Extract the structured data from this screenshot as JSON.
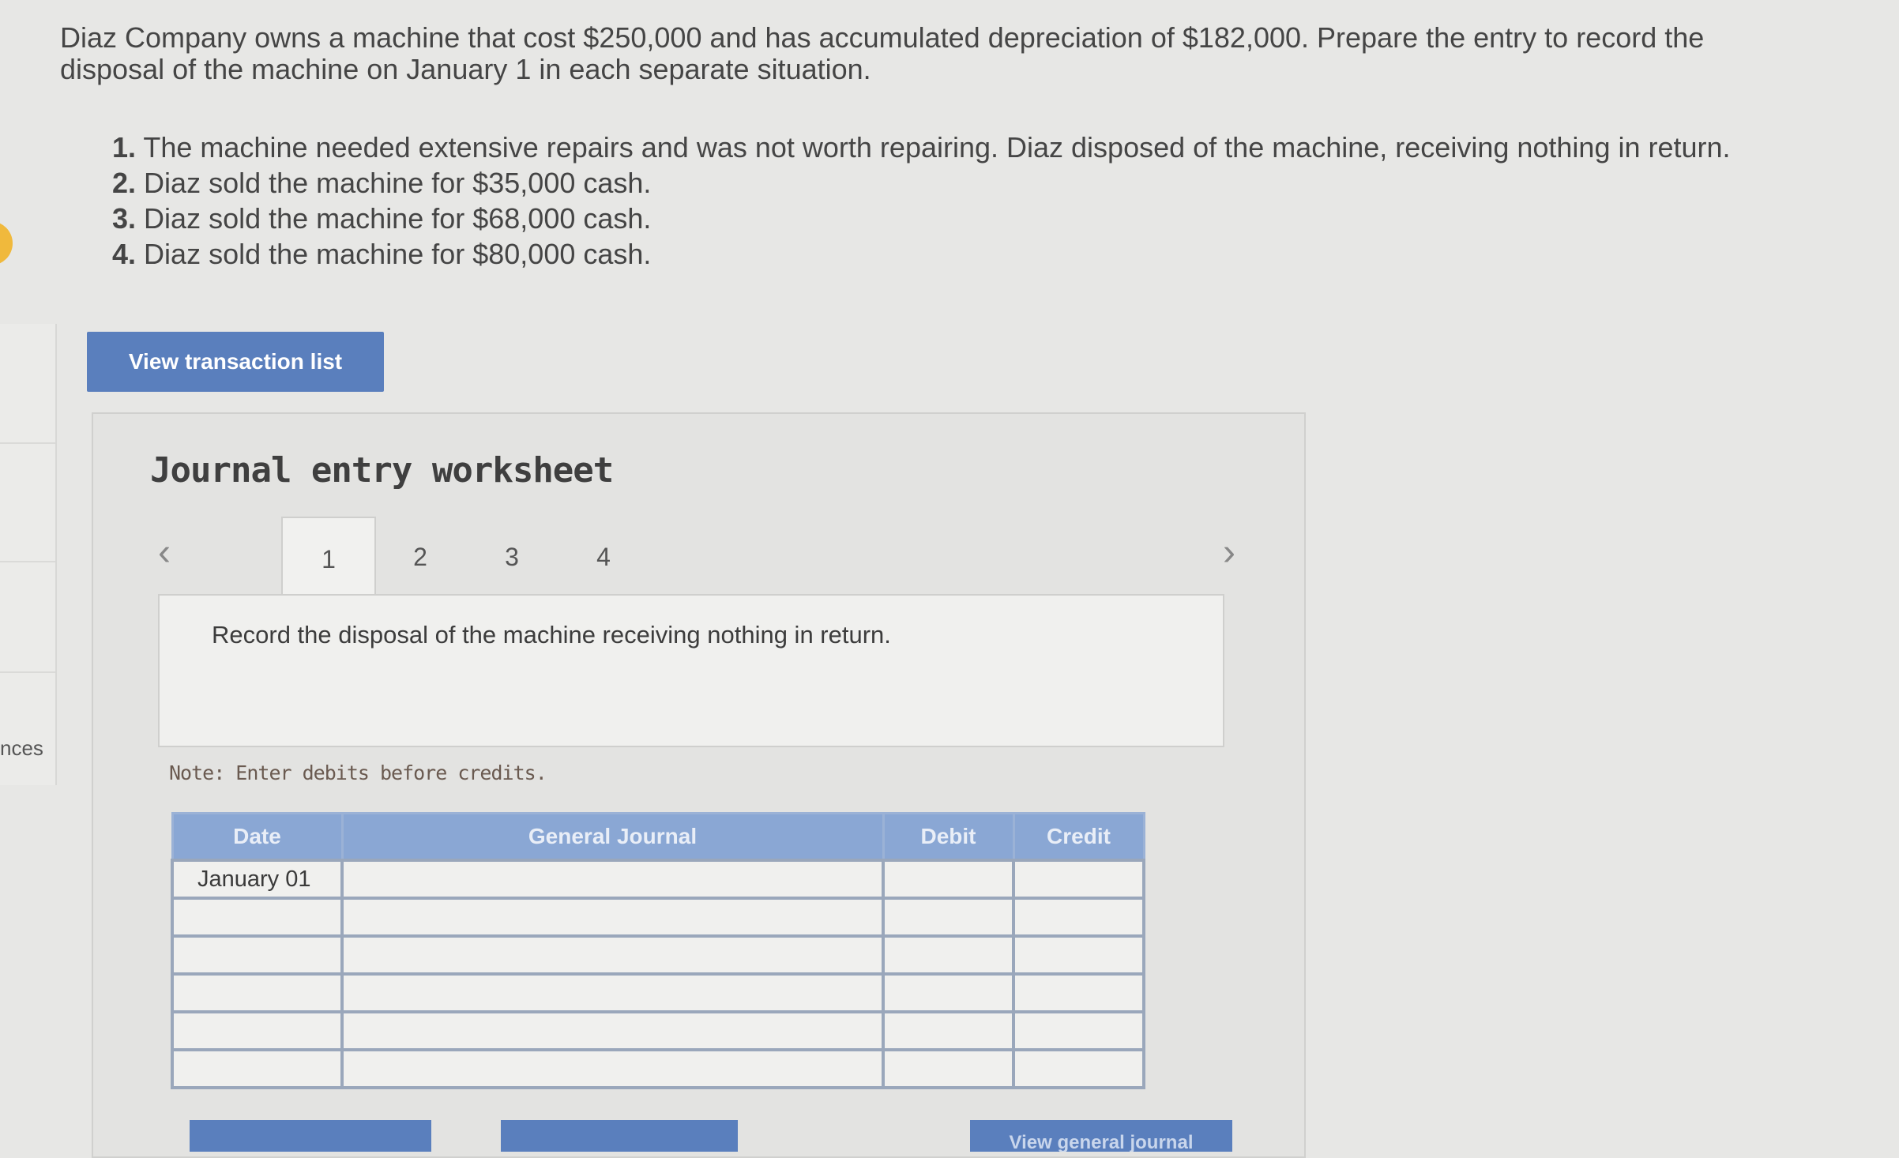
{
  "problem": {
    "prompt": "Diaz Company owns a machine that cost $250,000 and has accumulated depreciation of $182,000. Prepare the entry to record the disposal of the machine on January 1 in each separate situation.",
    "situations": [
      {
        "num": "1.",
        "text": "The machine needed extensive repairs and was not worth repairing. Diaz disposed of the machine, receiving nothing in return."
      },
      {
        "num": "2.",
        "text": "Diaz sold the machine for $35,000 cash."
      },
      {
        "num": "3.",
        "text": "Diaz sold the machine for $68,000 cash."
      },
      {
        "num": "4.",
        "text": "Diaz sold the machine for $80,000 cash."
      }
    ]
  },
  "sidebar": {
    "partial_label": "nces"
  },
  "buttons": {
    "view_transaction_list": "View transaction list",
    "bottom": [
      "",
      "",
      "View general journal"
    ]
  },
  "worksheet": {
    "title": "Journal entry worksheet",
    "tabs": [
      "1",
      "2",
      "3",
      "4"
    ],
    "active_tab": "1",
    "instruction": "Record the disposal of the machine receiving nothing in return.",
    "note": "Note: Enter debits before credits.",
    "columns": [
      "Date",
      "General Journal",
      "Debit",
      "Credit"
    ],
    "rows": [
      {
        "date": "January 01",
        "account": "",
        "debit": "",
        "credit": ""
      },
      {
        "date": "",
        "account": "",
        "debit": "",
        "credit": ""
      },
      {
        "date": "",
        "account": "",
        "debit": "",
        "credit": ""
      },
      {
        "date": "",
        "account": "",
        "debit": "",
        "credit": ""
      },
      {
        "date": "",
        "account": "",
        "debit": "",
        "credit": ""
      },
      {
        "date": "",
        "account": "",
        "debit": "",
        "credit": ""
      }
    ]
  }
}
